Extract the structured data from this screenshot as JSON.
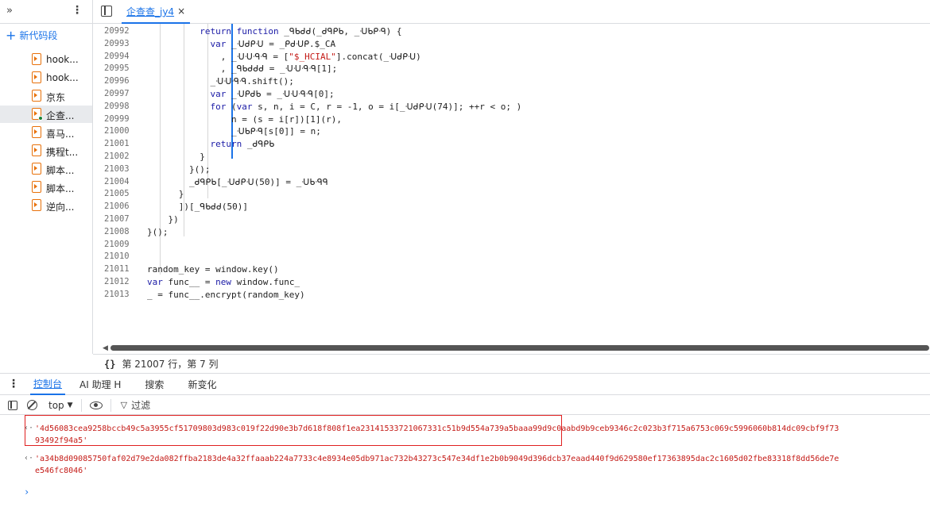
{
  "sidebar": {
    "new_snippet_label": "新代码段",
    "items": [
      {
        "label": "hook..."
      },
      {
        "label": "hook..."
      },
      {
        "label": "京东"
      },
      {
        "label": "企查..."
      },
      {
        "label": "喜马..."
      },
      {
        "label": "携程t..."
      },
      {
        "label": "脚本..."
      },
      {
        "label": "脚本..."
      },
      {
        "label": "逆向..."
      }
    ]
  },
  "editor": {
    "tab_label": "企查查_jy4",
    "tab_close": "×",
    "lines": [
      {
        "n": "20992",
        "t": "          return function _ᑫᑲᑯᑯ(_ᑯᑫᑭᑲ, _ᑗᑲᑭᑴ) {"
      },
      {
        "n": "20993",
        "t": "            var _ᑗᑯᑭᑗ = _ᑭᑯᑗᑭ.$_CA"
      },
      {
        "n": "20994",
        "t": "              , _ᑗᑗᑴᑴ = [\"$_HCIAL\"].concat(_ᑗᑯᑭᑗ)"
      },
      {
        "n": "20995",
        "t": "              , _ᑫᑲᑯᑯᑯ = _ᑗᑗᑴᑴ[1];"
      },
      {
        "n": "20996",
        "t": "            _ᑗᑗᑴᑴ.shift();"
      },
      {
        "n": "20997",
        "t": "            var _ᑗᑭᑯᑲ = _ᑗᑗᑴᑴ[0];"
      },
      {
        "n": "20998",
        "t": "            for (var s, n, i = C, r = -1, o = i[_ᑗᑯᑭᑗ(74)]; ++r < o; )"
      },
      {
        "n": "20999",
        "t": "                n = (s = i[r])[1](r),"
      },
      {
        "n": "21000",
        "t": "                _ᑗᑲᑭᑴ[s[0]] = n;"
      },
      {
        "n": "21001",
        "t": "            return _ᑯᑫᑭᑲ"
      },
      {
        "n": "21002",
        "t": "          }"
      },
      {
        "n": "21003",
        "t": "        }();"
      },
      {
        "n": "21004",
        "t": "        _ᑯᑫᑭᑲ[_ᑗᑯᑭᑗ(50)] = _ᑗᑲᑴᑫ"
      },
      {
        "n": "21005",
        "t": "      }"
      },
      {
        "n": "21006",
        "t": "      ])[_ᑫᑲᑯᑯ(50)]"
      },
      {
        "n": "21007",
        "t": "    })"
      },
      {
        "n": "21008",
        "t": "}();"
      },
      {
        "n": "21009",
        "t": ""
      },
      {
        "n": "21010",
        "t": ""
      },
      {
        "n": "21011",
        "t": "random_key = window.key()"
      },
      {
        "n": "21012",
        "t": "var func__ = new window.func_"
      },
      {
        "n": "21013",
        "t": "_ = func__.encrypt(random_key)"
      }
    ]
  },
  "status": {
    "braces": "{}",
    "position": "第 21007 行，第 7 列"
  },
  "drawer": {
    "tabs": [
      "控制台",
      "AI 助理 ᕼ",
      "搜索",
      "新变化"
    ]
  },
  "console_toolbar": {
    "context": "top",
    "filter_label": "过滤"
  },
  "console": {
    "entries": [
      {
        "line1": "'4d56083cea9258bccb49c5a3955cf51709803d983c019f22d90e3b7d618f808f1ea23141533721067331c51b9d554a739a5baaa99d9c0aabd9b9ceb9346c2c023b3f715a6753c069c5996060b814dc09cbf9f73",
        "line2": "93492f94a5'"
      },
      {
        "line1": "'a34b8d09085750faf02d79e2da082ffba2183de4a32ffaaab224a7733c4e8934e05db971ac732b43273c547e34df1e2b0b9049d396dcb37eaad440f9d629580ef17363895dac2c1605d02fbe83318f8dd56de7e",
        "line2": "e546fc8046'"
      }
    ]
  }
}
